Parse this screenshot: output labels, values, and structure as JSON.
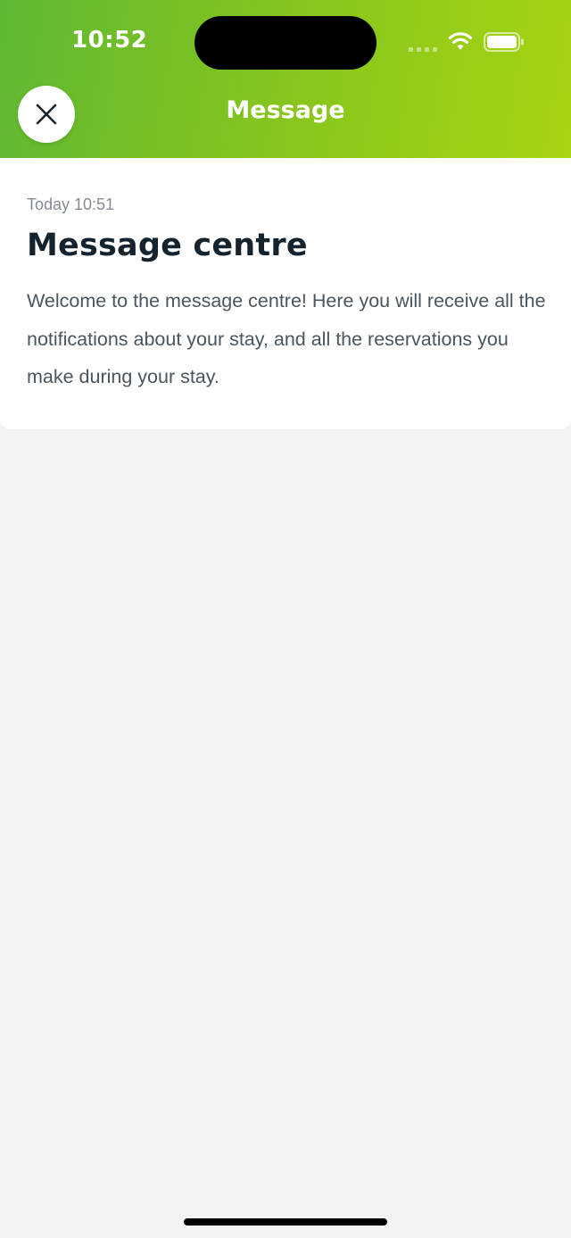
{
  "status_bar": {
    "time": "10:52"
  },
  "header": {
    "title": "Message",
    "close_icon": "close-icon"
  },
  "message": {
    "timestamp": "Today 10:51",
    "title": "Message centre",
    "body": "Welcome to the message centre! Here you will receive all the notifications about your stay, and all the reservations you make during your stay."
  },
  "colors": {
    "header_gradient_start": "#5fb832",
    "header_gradient_end": "#a8d412",
    "title_text": "#14232e",
    "body_text": "#4a555e",
    "timestamp_text": "#858c94",
    "background": "#f2f3f5"
  }
}
